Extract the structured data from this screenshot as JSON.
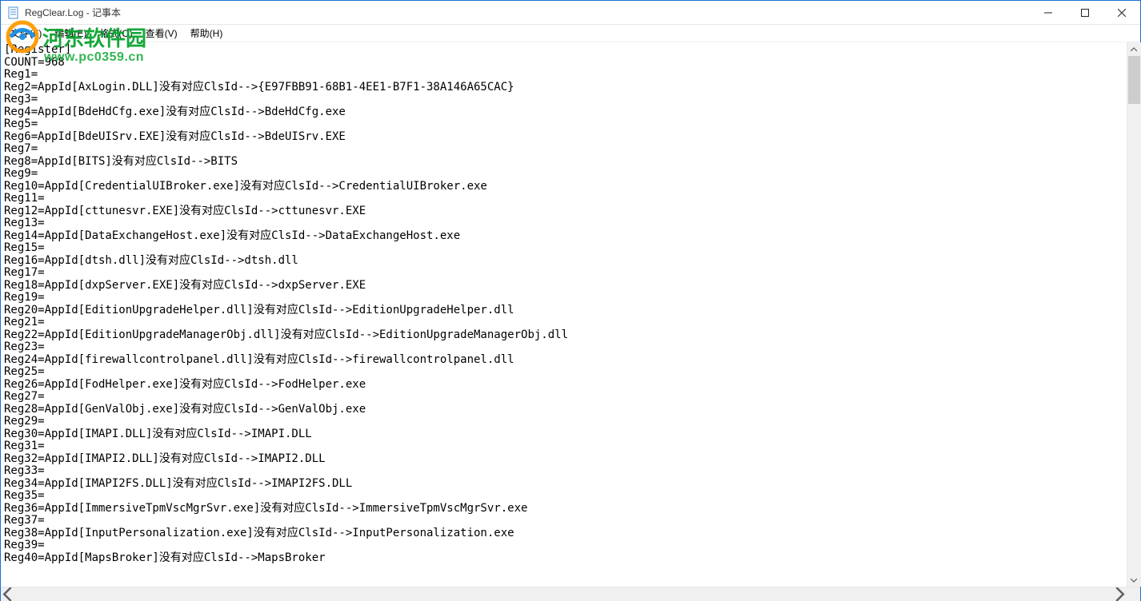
{
  "window": {
    "title": "RegClear.Log - 记事本"
  },
  "menu": {
    "file": "文件(F)",
    "edit": "编辑(E)",
    "format": "格式(O)",
    "view": "查看(V)",
    "help": "帮助(H)"
  },
  "watermark": {
    "cn": "河东软件园",
    "url": "www.pc0359.cn"
  },
  "content_lines": [
    "[Register]",
    "COUNT=968",
    "Reg1=",
    "Reg2=AppId[AxLogin.DLL]没有对应ClsId-->{E97FBB91-68B1-4EE1-B7F1-38A146A65CAC}",
    "Reg3=",
    "Reg4=AppId[BdeHdCfg.exe]没有对应ClsId-->BdeHdCfg.exe",
    "Reg5=",
    "Reg6=AppId[BdeUISrv.EXE]没有对应ClsId-->BdeUISrv.EXE",
    "Reg7=",
    "Reg8=AppId[BITS]没有对应ClsId-->BITS",
    "Reg9=",
    "Reg10=AppId[CredentialUIBroker.exe]没有对应ClsId-->CredentialUIBroker.exe",
    "Reg11=",
    "Reg12=AppId[cttunesvr.EXE]没有对应ClsId-->cttunesvr.EXE",
    "Reg13=",
    "Reg14=AppId[DataExchangeHost.exe]没有对应ClsId-->DataExchangeHost.exe",
    "Reg15=",
    "Reg16=AppId[dtsh.dll]没有对应ClsId-->dtsh.dll",
    "Reg17=",
    "Reg18=AppId[dxpServer.EXE]没有对应ClsId-->dxpServer.EXE",
    "Reg19=",
    "Reg20=AppId[EditionUpgradeHelper.dll]没有对应ClsId-->EditionUpgradeHelper.dll",
    "Reg21=",
    "Reg22=AppId[EditionUpgradeManagerObj.dll]没有对应ClsId-->EditionUpgradeManagerObj.dll",
    "Reg23=",
    "Reg24=AppId[firewallcontrolpanel.dll]没有对应ClsId-->firewallcontrolpanel.dll",
    "Reg25=",
    "Reg26=AppId[FodHelper.exe]没有对应ClsId-->FodHelper.exe",
    "Reg27=",
    "Reg28=AppId[GenValObj.exe]没有对应ClsId-->GenValObj.exe",
    "Reg29=",
    "Reg30=AppId[IMAPI.DLL]没有对应ClsId-->IMAPI.DLL",
    "Reg31=",
    "Reg32=AppId[IMAPI2.DLL]没有对应ClsId-->IMAPI2.DLL",
    "Reg33=",
    "Reg34=AppId[IMAPI2FS.DLL]没有对应ClsId-->IMAPI2FS.DLL",
    "Reg35=",
    "Reg36=AppId[ImmersiveTpmVscMgrSvr.exe]没有对应ClsId-->ImmersiveTpmVscMgrSvr.exe",
    "Reg37=",
    "Reg38=AppId[InputPersonalization.exe]没有对应ClsId-->InputPersonalization.exe",
    "Reg39=",
    "Reg40=AppId[MapsBroker]没有对应ClsId-->MapsBroker"
  ]
}
